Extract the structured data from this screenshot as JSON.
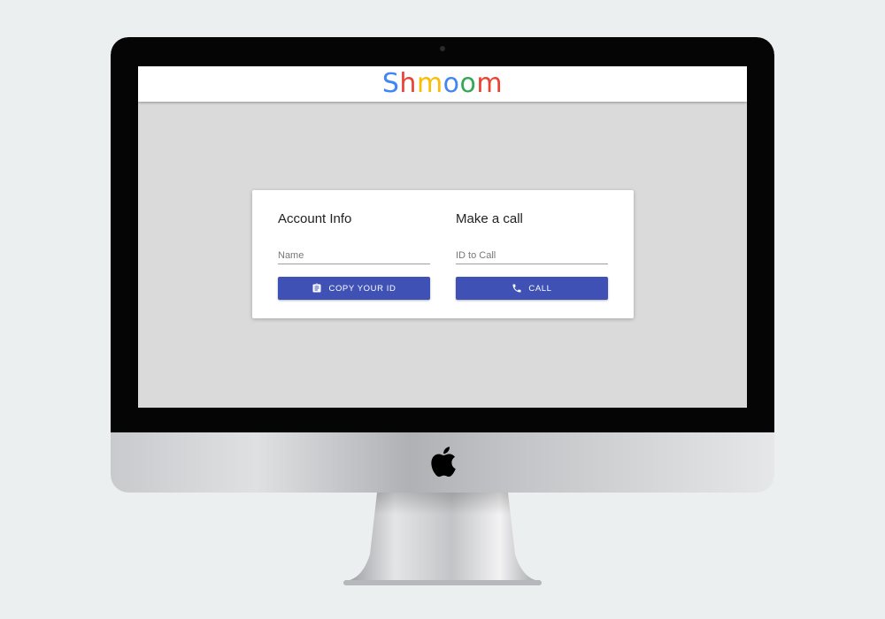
{
  "app": {
    "logo_letters": [
      {
        "char": "S",
        "color": "#4285f4"
      },
      {
        "char": "h",
        "color": "#ea4335"
      },
      {
        "char": "m",
        "color": "#fbbc05"
      },
      {
        "char": "o",
        "color": "#4285f4"
      },
      {
        "char": "o",
        "color": "#34a853"
      },
      {
        "char": "m",
        "color": "#ea4335"
      }
    ]
  },
  "account": {
    "title": "Account Info",
    "name_placeholder": "Name",
    "name_value": "",
    "copy_button_label": "COPY YOUR ID",
    "copy_button_icon": "clipboard-icon"
  },
  "call": {
    "title": "Make a call",
    "id_placeholder": "ID to Call",
    "id_value": "",
    "call_button_label": "CALL",
    "call_button_icon": "phone-icon"
  },
  "colors": {
    "primary": "#3f51b5",
    "background": "#dadada"
  }
}
